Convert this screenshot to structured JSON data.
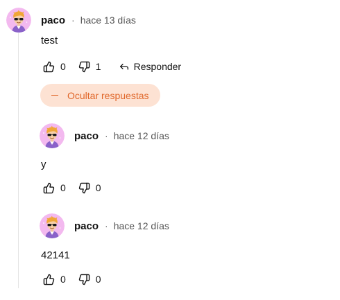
{
  "colors": {
    "accent": "#e0672a",
    "accent_bg": "#fde2d3",
    "avatar_bg": "#f3b9ef"
  },
  "comment": {
    "author": "paco",
    "separator": "·",
    "time": "hace 13 días",
    "text": "test",
    "likes": "0",
    "dislikes": "1",
    "reply_label": "Responder"
  },
  "replies_toggle": {
    "label": "Ocultar respuestas",
    "icon": "minus-icon"
  },
  "replies": [
    {
      "author": "paco",
      "separator": "·",
      "time": "hace 12 días",
      "text": "y",
      "likes": "0",
      "dislikes": "0"
    },
    {
      "author": "paco",
      "separator": "·",
      "time": "hace 12 días",
      "text": "42141",
      "likes": "0",
      "dislikes": "0"
    }
  ]
}
